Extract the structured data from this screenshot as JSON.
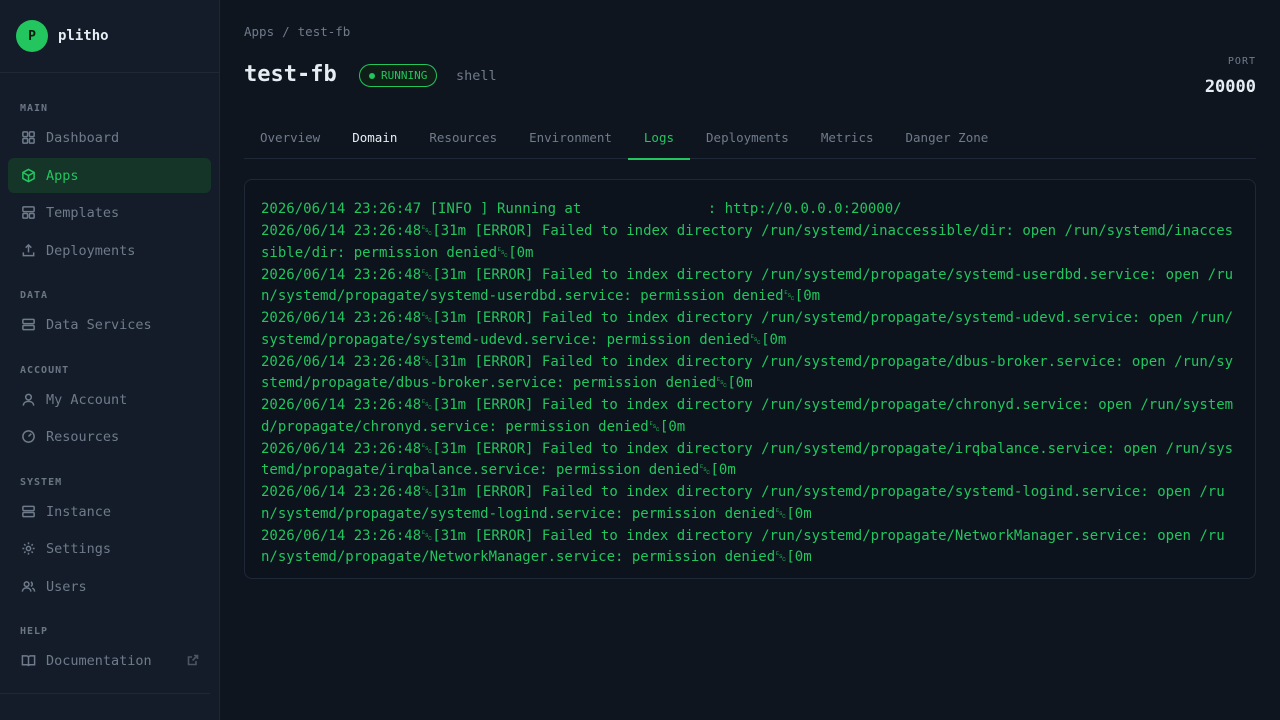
{
  "brand": {
    "logo_letter": "P",
    "name": "plitho"
  },
  "sidebar": {
    "sections": {
      "main": "MAIN",
      "data": "DATA",
      "account": "ACCOUNT",
      "system": "SYSTEM",
      "help": "HELP"
    },
    "items": {
      "dashboard": "Dashboard",
      "apps": "Apps",
      "templates": "Templates",
      "deployments": "Deployments",
      "data_services": "Data Services",
      "my_account": "My Account",
      "resources": "Resources",
      "instance": "Instance",
      "settings": "Settings",
      "users": "Users",
      "documentation": "Documentation"
    },
    "active_item": "apps"
  },
  "breadcrumb": {
    "parent": "Apps",
    "separator": "/",
    "current": "test-fb"
  },
  "app": {
    "name": "test-fb",
    "status": "RUNNING",
    "type": "shell",
    "port_label": "PORT",
    "port": "20000"
  },
  "tabs": [
    {
      "label": "Overview"
    },
    {
      "label": "Domain"
    },
    {
      "label": "Resources"
    },
    {
      "label": "Environment"
    },
    {
      "label": "Logs"
    },
    {
      "label": "Deployments"
    },
    {
      "label": "Metrics"
    },
    {
      "label": "Danger Zone"
    }
  ],
  "active_tab": "Logs",
  "logs": [
    "2026/06/14 23:26:47 [INFO ] Running at               : http://0.0.0.0:20000/",
    "2026/06/14 23:26:48␛[31m [ERROR] Failed to index directory /run/systemd/inaccessible/dir: open /run/systemd/inaccessible/dir: permission denied␛[0m",
    "2026/06/14 23:26:48␛[31m [ERROR] Failed to index directory /run/systemd/propagate/systemd-userdbd.service: open /run/systemd/propagate/systemd-userdbd.service: permission denied␛[0m",
    "2026/06/14 23:26:48␛[31m [ERROR] Failed to index directory /run/systemd/propagate/systemd-udevd.service: open /run/systemd/propagate/systemd-udevd.service: permission denied␛[0m",
    "2026/06/14 23:26:48␛[31m [ERROR] Failed to index directory /run/systemd/propagate/dbus-broker.service: open /run/systemd/propagate/dbus-broker.service: permission denied␛[0m",
    "2026/06/14 23:26:48␛[31m [ERROR] Failed to index directory /run/systemd/propagate/chronyd.service: open /run/systemd/propagate/chronyd.service: permission denied␛[0m",
    "2026/06/14 23:26:48␛[31m [ERROR] Failed to index directory /run/systemd/propagate/irqbalance.service: open /run/systemd/propagate/irqbalance.service: permission denied␛[0m",
    "2026/06/14 23:26:48␛[31m [ERROR] Failed to index directory /run/systemd/propagate/systemd-logind.service: open /run/systemd/propagate/systemd-logind.service: permission denied␛[0m",
    "2026/06/14 23:26:48␛[31m [ERROR] Failed to index directory /run/systemd/propagate/NetworkManager.service: open /run/systemd/propagate/NetworkManager.service: permission denied␛[0m"
  ],
  "colors": {
    "accent": "#22c55e",
    "background": "#0f151f",
    "sidebar": "#131c28"
  },
  "icons": {
    "dashboard": "grid-icon",
    "apps": "cube-icon",
    "templates": "layout-icon",
    "deployments": "upload-icon",
    "data_services": "database-icon",
    "my_account": "user-icon",
    "resources": "gauge-icon",
    "instance": "server-icon",
    "settings": "gear-icon",
    "users": "users-icon",
    "documentation": "book-icon",
    "external": "external-link-icon"
  }
}
